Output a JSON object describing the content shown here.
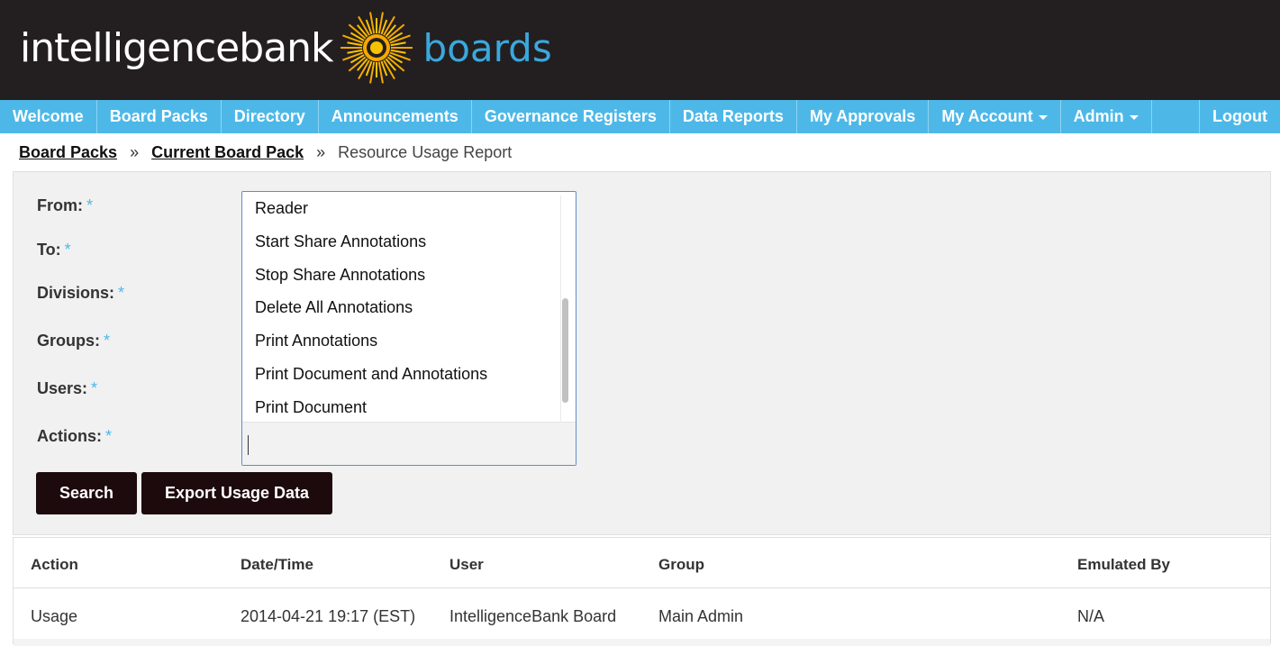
{
  "header": {
    "logo_intelligence": "intelligence",
    "logo_bank": "bank",
    "logo_boards": "boards"
  },
  "nav": {
    "items": [
      "Welcome",
      "Board Packs",
      "Directory",
      "Announcements",
      "Governance Registers",
      "Data Reports",
      "My Approvals",
      "My Account",
      "Admin"
    ],
    "logout": "Logout"
  },
  "breadcrumb": {
    "board_packs": "Board Packs",
    "current_board_pack": "Current Board Pack",
    "current": "Resource Usage Report",
    "separator": "»"
  },
  "form": {
    "labels": {
      "from": "From:",
      "to": "To:",
      "divisions": "Divisions:",
      "groups": "Groups:",
      "users": "Users:",
      "actions": "Actions:"
    },
    "required_mark": "*",
    "actions_dropdown": {
      "options": [
        "Reader",
        "Start Share Annotations",
        "Stop Share Annotations",
        "Delete All Annotations",
        "Print Annotations",
        "Print Document and Annotations",
        "Print Document"
      ],
      "search_value": ""
    },
    "search_button": "Search",
    "export_button": "Export Usage Data"
  },
  "table": {
    "columns": [
      "Action",
      "Date/Time",
      "User",
      "Group",
      "Emulated By"
    ],
    "rows": [
      [
        "Usage",
        "2014-04-21 19:17 (EST)",
        "IntelligenceBank Board",
        "Main Admin",
        "N/A"
      ]
    ]
  },
  "colors": {
    "header_bg": "#231f20",
    "nav_bg": "#4db8e8",
    "button_bg": "#1d0a0d",
    "accent": "#3aa8dd",
    "sun": "#f7a800"
  }
}
